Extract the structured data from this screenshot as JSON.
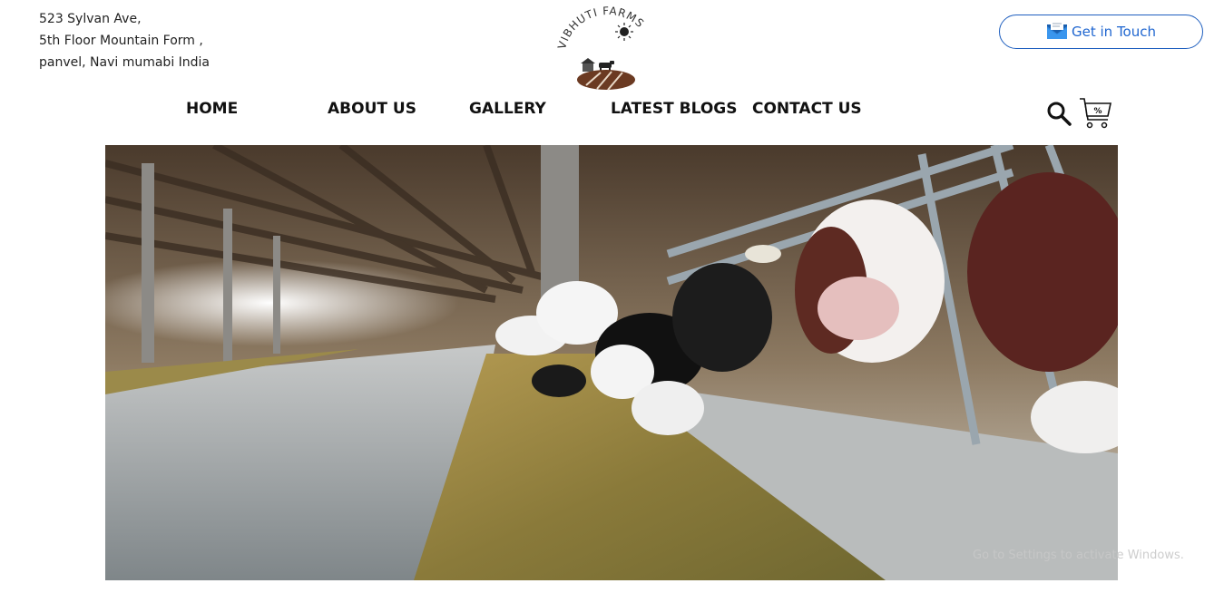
{
  "address": {
    "line1": "523 Sylvan Ave,",
    "line2": "5th Floor Mountain Form ,",
    "line3": "panvel, Navi mumabi India"
  },
  "logo": {
    "text": "VIBHUTI FARMS"
  },
  "header": {
    "contact_label": "Get in Touch"
  },
  "nav": {
    "items": [
      {
        "label": "HOME"
      },
      {
        "label": "ABOUT US"
      },
      {
        "label": "GALLERY"
      },
      {
        "label": "LATEST BLOGS"
      },
      {
        "label": "CONTACT US"
      }
    ]
  },
  "icons": {
    "search": "search-icon",
    "cart": "cart-icon",
    "mail": "mail-icon"
  },
  "cart": {
    "badge": "%"
  },
  "watermark": {
    "text": "Go to Settings to activate Windows."
  },
  "colors": {
    "accent": "#1f66d0",
    "soil": "#6b3a22"
  }
}
